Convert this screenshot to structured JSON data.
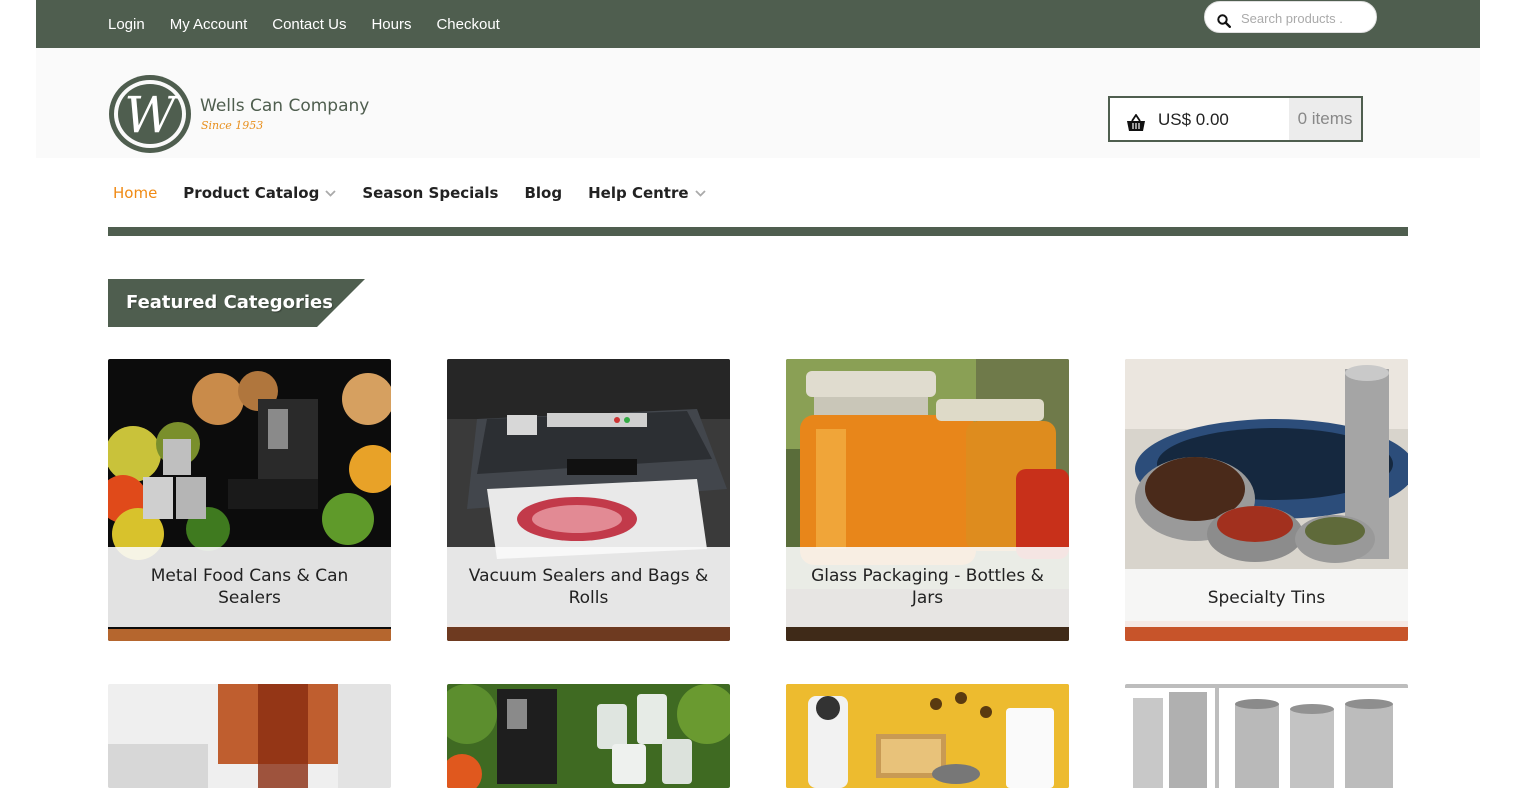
{
  "top_nav": {
    "links": [
      "Login",
      "My Account",
      "Contact Us",
      "Hours",
      "Checkout"
    ],
    "search_placeholder": "Search products ."
  },
  "brand": {
    "logo_letter": "W",
    "name": "Wells Can Company",
    "tagline": "Since 1953"
  },
  "cart": {
    "amount": "US$ 0.00",
    "items": "0 items"
  },
  "main_nav": {
    "items": [
      {
        "label": "Home",
        "active": true,
        "has_dropdown": false
      },
      {
        "label": "Product Catalog",
        "active": false,
        "has_dropdown": true
      },
      {
        "label": "Season Specials",
        "active": false,
        "has_dropdown": false
      },
      {
        "label": "Blog",
        "active": false,
        "has_dropdown": false
      },
      {
        "label": "Help Centre",
        "active": false,
        "has_dropdown": true
      }
    ]
  },
  "featured": {
    "heading": "Featured Categories",
    "categories": [
      {
        "label": "Metal Food Cans & Can Sealers"
      },
      {
        "label": "Vacuum Sealers and Bags & Rolls"
      },
      {
        "label": "Glass Packaging - Bottles & Jars"
      },
      {
        "label": "Specialty Tins"
      }
    ]
  },
  "colors": {
    "brand_green": "#4f5e4f",
    "accent_orange": "#f08a14"
  }
}
